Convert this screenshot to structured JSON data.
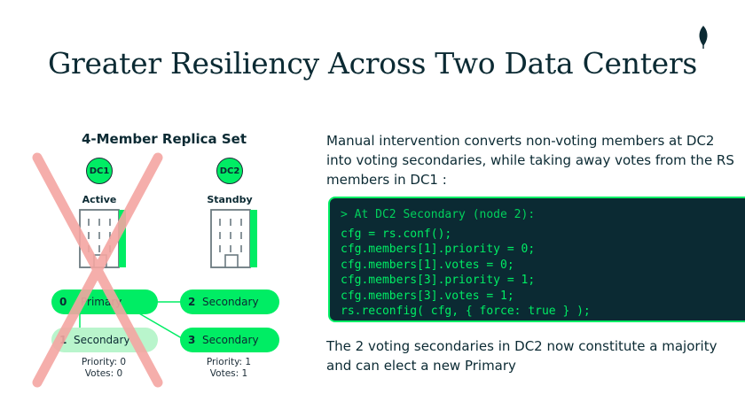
{
  "slide": {
    "title": "Greater Resiliency Across Two Data Centers",
    "logo_icon": "leaf-icon"
  },
  "diagram": {
    "title": "4-Member Replica Set",
    "datacenters": [
      {
        "label": "DC1",
        "state": "Active",
        "icon": "building-icon",
        "crossed_out": true
      },
      {
        "label": "DC2",
        "state": "Standby",
        "icon": "building-icon",
        "crossed_out": false
      }
    ],
    "members": [
      {
        "id": "0",
        "role": "Primary",
        "dc": "DC1"
      },
      {
        "id": "1",
        "role": "Secondary",
        "dc": "DC1"
      },
      {
        "id": "2",
        "role": "Secondary",
        "dc": "DC2"
      },
      {
        "id": "3",
        "role": "Secondary",
        "dc": "DC2"
      }
    ],
    "dc1_stats": {
      "priority": "Priority: 0",
      "votes": "Votes: 0"
    },
    "dc2_stats": {
      "priority": "Priority: 1",
      "votes": "Votes: 1"
    }
  },
  "text": {
    "intro": "Manual intervention converts non-voting members at DC2 into voting secondaries, while taking away votes from the RS members in DC1 :",
    "outro": "The 2 voting secondaries in DC2 now constitute a majority and can elect a new Primary"
  },
  "code": {
    "comment": "> At DC2 Secondary (node 2):",
    "lines": [
      "cfg = rs.conf();",
      "cfg.members[1].priority = 0;",
      "cfg.members[1].votes = 0;",
      "cfg.members[3].priority = 1;",
      "cfg.members[3].votes = 1;",
      "rs.reconfig( cfg, { force: true } );"
    ]
  },
  "colors": {
    "accent": "#00ed64",
    "accent_faded": "#b9f5cc",
    "dark": "#0b2a33",
    "cross": "#f4a6a2"
  }
}
